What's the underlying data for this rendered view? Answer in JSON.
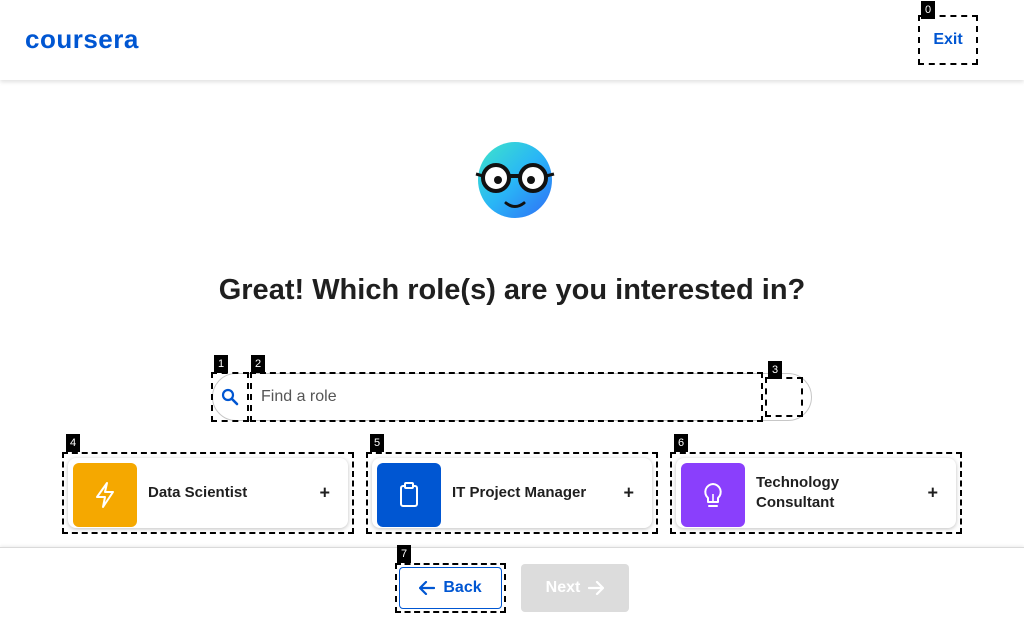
{
  "header": {
    "logo": "coursera",
    "exit_label": "Exit"
  },
  "main": {
    "title": "Great! Which role(s) are you interested in?",
    "search": {
      "placeholder": "Find a role",
      "value": ""
    }
  },
  "roles": [
    {
      "label": "Data Scientist",
      "icon": "lightning-icon",
      "color": "#f5a800"
    },
    {
      "label": "IT Project Manager",
      "icon": "clipboard-icon",
      "color": "#0056d2"
    },
    {
      "label": "Technology Consultant",
      "icon": "lightbulb-icon",
      "color": "#8a3ffc"
    }
  ],
  "footer": {
    "back_label": "Back",
    "next_label": "Next"
  },
  "overlay_tags": [
    "0",
    "1",
    "2",
    "3",
    "4",
    "5",
    "6",
    "7"
  ],
  "colors": {
    "brand": "#0056d2",
    "disabled": "#dcdcdc"
  }
}
